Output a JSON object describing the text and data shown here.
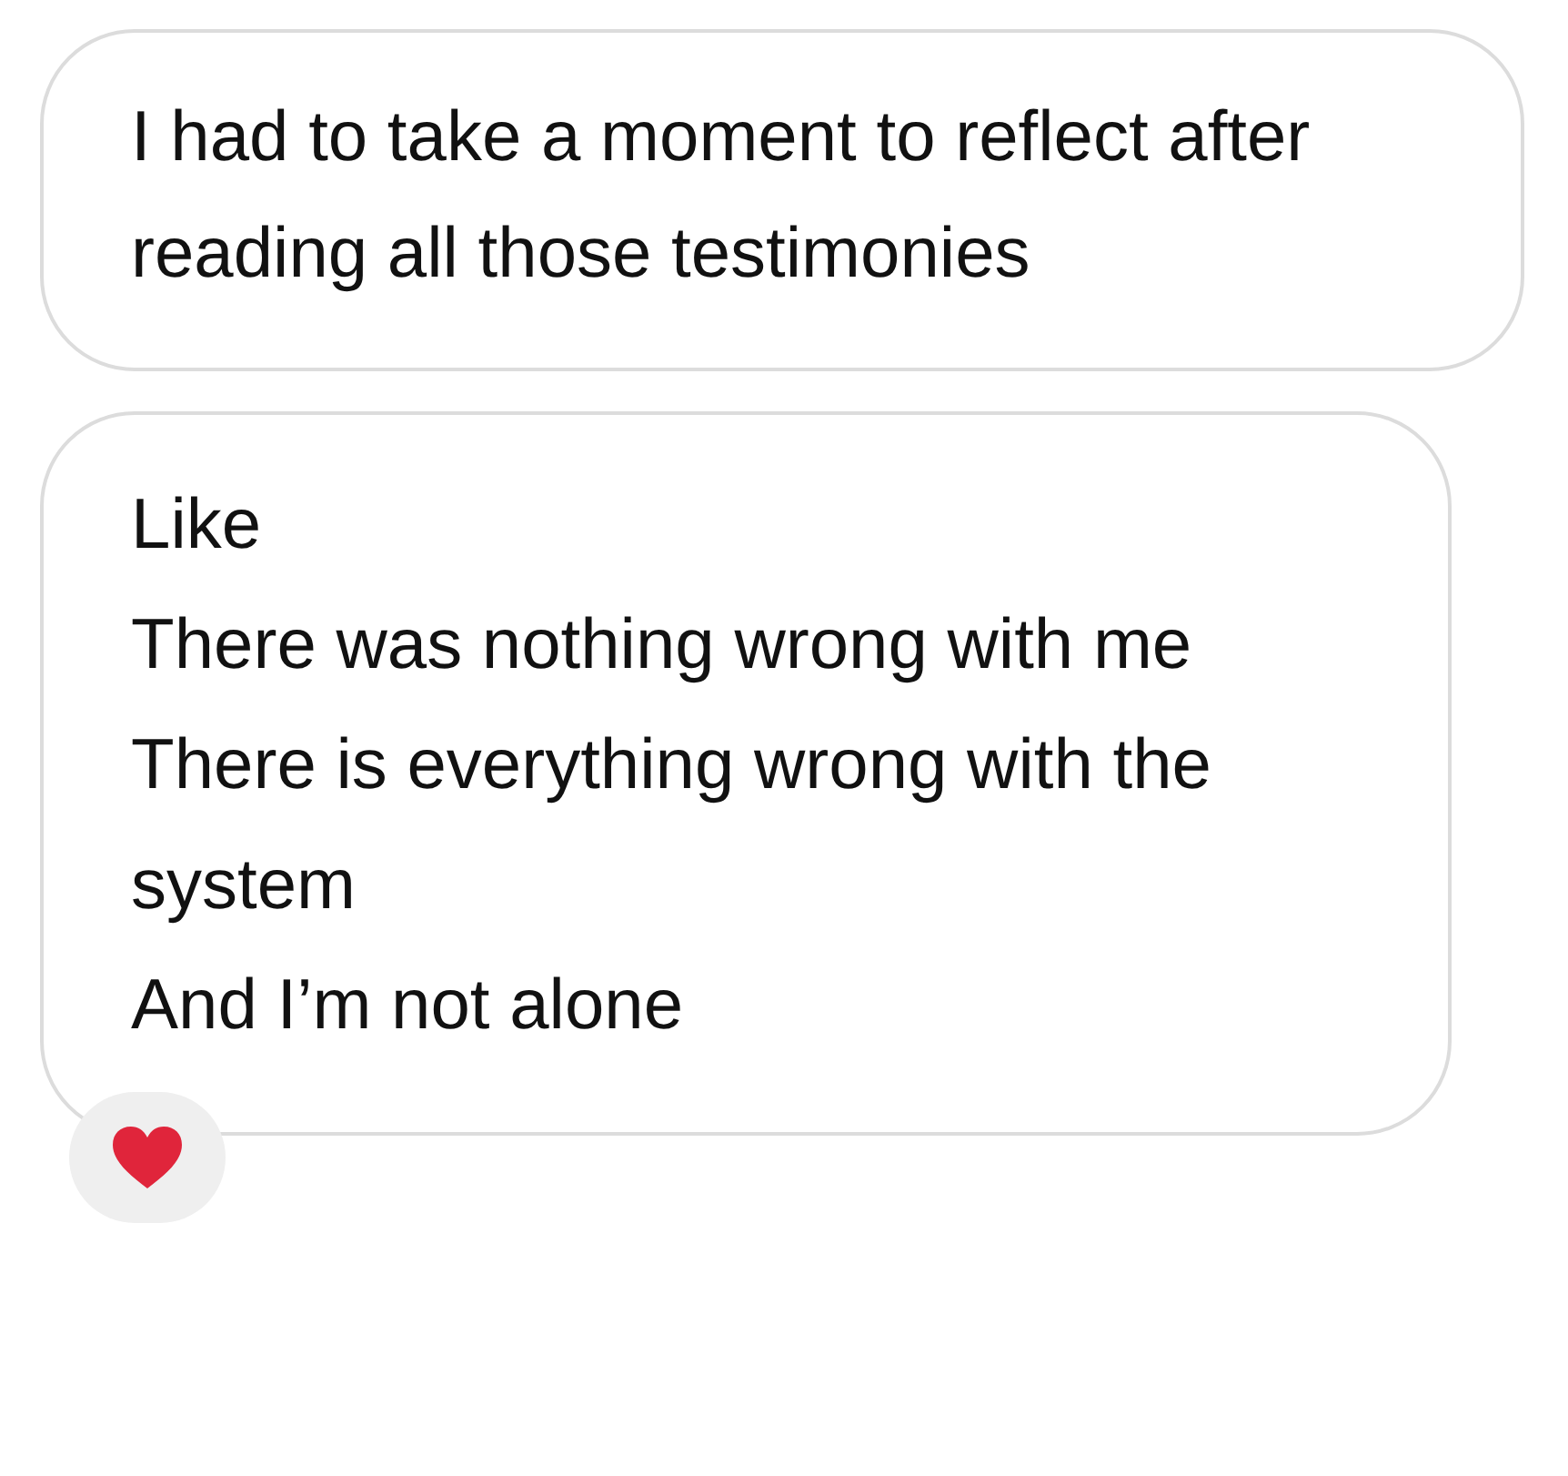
{
  "messages": [
    {
      "lines": [
        "I had to take a moment to reflect after reading all those testimonies"
      ]
    },
    {
      "lines": [
        "Like",
        "There was nothing wrong with me",
        "There is everything wrong with the system",
        "And I’m not alone"
      ],
      "reaction": {
        "kind": "heart"
      }
    }
  ]
}
